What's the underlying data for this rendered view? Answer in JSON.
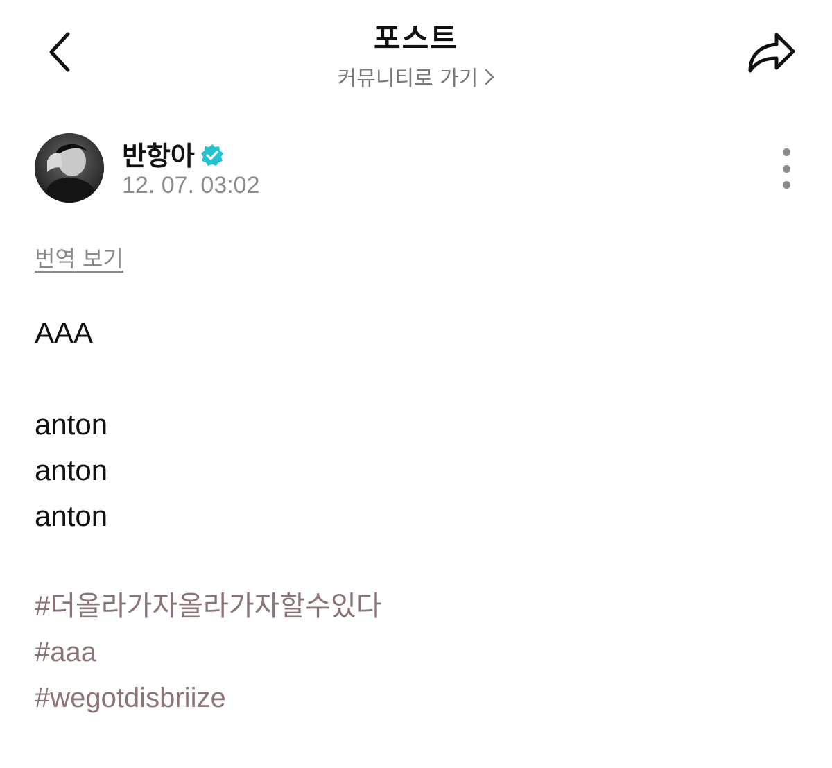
{
  "header": {
    "title": "포스트",
    "community_link": "커뮤니티로 가기"
  },
  "author": {
    "name": "반항아",
    "timestamp": "12. 07. 03:02",
    "verified": true,
    "verified_color": "#22c3cf"
  },
  "post": {
    "translate_label": "번역 보기",
    "lines": [
      "AAA",
      "anton",
      "anton",
      "anton"
    ],
    "hashtags": [
      "#더올라가자올라가자할수있다",
      "#aaa",
      "#wegotdisbriize"
    ]
  },
  "colors": {
    "hashtag": "#8a7574",
    "muted": "#8a8a8a"
  },
  "icons": {
    "back": "chevron-left-icon",
    "share": "share-arrow-icon",
    "more": "more-vertical-icon",
    "verified": "verified-badge-icon"
  }
}
